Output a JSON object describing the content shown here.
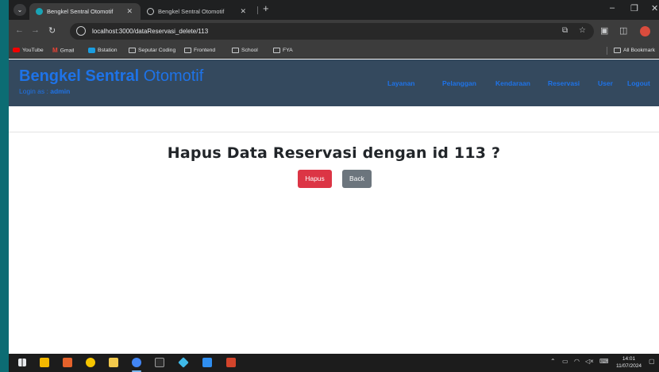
{
  "browser": {
    "tabs": [
      {
        "title": "Bengkel Sentral Otomotif",
        "active": true
      },
      {
        "title": "Bengkel Sentral Otomotif",
        "active": false
      }
    ],
    "address": "localhost:3000/dataReservasi_delete/113",
    "bookmarks": [
      {
        "label": "YouTube",
        "icon": "youtube-icon"
      },
      {
        "label": "Gmail",
        "icon": "gmail-icon"
      },
      {
        "label": "Bstation",
        "icon": "bstation-icon"
      },
      {
        "label": "Seputar Coding",
        "icon": "folder-icon"
      },
      {
        "label": "Frontend",
        "icon": "folder-icon"
      },
      {
        "label": "School",
        "icon": "folder-icon"
      },
      {
        "label": "FYA",
        "icon": "folder-icon"
      }
    ],
    "all_bookmarks": "All Bookmark"
  },
  "site": {
    "brand_bold": "Bengkel Sentral",
    "brand_light": "Otomotif",
    "login_prefix": "Login as :",
    "login_user": "admin",
    "nav": [
      "Layanan",
      "Pelanggan",
      "Kendaraan",
      "Reservasi",
      "User",
      "Logout"
    ],
    "accent": "#1e73e8",
    "nav_bg": "#34495e"
  },
  "content": {
    "title": "Hapus Data Reservasi dengan id 113 ?",
    "delete_label": "Hapus",
    "back_label": "Back",
    "danger_color": "#dc3545",
    "secondary_color": "#6c757d"
  },
  "taskbar": {
    "time": "14:01",
    "date": "11/07/2024"
  }
}
